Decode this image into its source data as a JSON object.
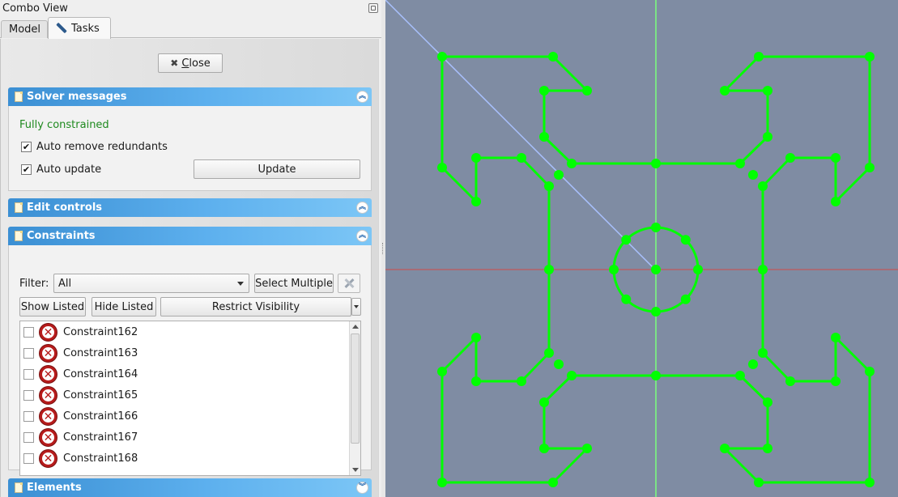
{
  "combo": {
    "title": "Combo View",
    "tabs": {
      "model": "Model",
      "tasks": "Tasks"
    }
  },
  "tasks": {
    "close_label": "Close",
    "solver": {
      "header": "Solver messages",
      "status": "Fully constrained",
      "auto_remove_label": "Auto remove redundants",
      "auto_remove_checked": true,
      "auto_update_label": "Auto update",
      "auto_update_checked": true,
      "update_button": "Update"
    },
    "edit_controls": {
      "header": "Edit controls"
    },
    "constraints": {
      "header": "Constraints",
      "filter_label": "Filter:",
      "filter_value": "All",
      "select_multiple": "Select Multiple",
      "show_listed": "Show Listed",
      "hide_listed": "Hide Listed",
      "restrict_visibility": "Restrict Visibility",
      "items": [
        "Constraint162",
        "Constraint163",
        "Constraint164",
        "Constraint165",
        "Constraint166",
        "Constraint167",
        "Constraint168"
      ]
    },
    "elements": {
      "header": "Elements"
    }
  },
  "colors": {
    "sketch_geometry": "#00ff00",
    "view_background": "#7f8ca3",
    "x_axis": "#d14a4a",
    "y_axis": "#7cff7c",
    "construction_line": "#a9c1ff",
    "section_header": "#3b8fd3",
    "status_ok": "#1f8a1f",
    "constraint_error": "#b71c1c"
  }
}
